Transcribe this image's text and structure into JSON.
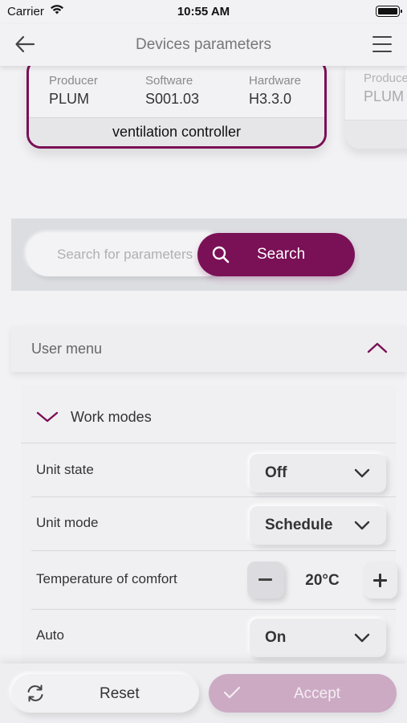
{
  "status_bar": {
    "carrier": "Carrier",
    "time": "10:55 AM"
  },
  "nav": {
    "title": "Devices parameters"
  },
  "devices": [
    {
      "producer_label": "Producer",
      "producer": "PLUM",
      "software_label": "Software",
      "software": "S001.03",
      "hardware_label": "Hardware",
      "hardware": "H3.3.0",
      "name": "ventilation controller"
    },
    {
      "producer_label": "Produce",
      "producer": "PLUM"
    }
  ],
  "search": {
    "placeholder": "Search for parameters",
    "button_label": "Search"
  },
  "user_menu": {
    "label": "User menu"
  },
  "work_modes": {
    "label": "Work modes",
    "params": [
      {
        "label": "Unit state",
        "value": "Off"
      },
      {
        "label": "Unit mode",
        "value": "Schedule"
      },
      {
        "label": "Temperature of comfort",
        "value": "20°C"
      },
      {
        "label": "Auto",
        "value": "On"
      }
    ]
  },
  "actions": {
    "reset": "Reset",
    "accept": "Accept"
  },
  "colors": {
    "accent": "#7a1056",
    "accept_disabled": "#ccaac4",
    "background": "#f2f2f4"
  }
}
